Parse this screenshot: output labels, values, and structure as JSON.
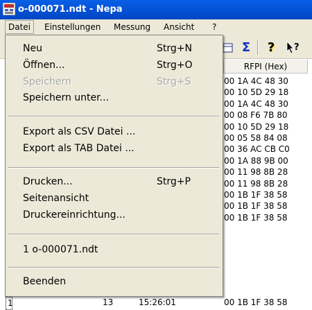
{
  "window": {
    "title": "o-000071.ndt - Nepa"
  },
  "menubar": {
    "items": [
      "Datei",
      "Einstellungen",
      "Messung",
      "Ansicht",
      "?"
    ]
  },
  "toolbar": {
    "sigma_symbol": "Σ",
    "help_symbol": "?"
  },
  "table": {
    "headers": {
      "rfpi": "RFPI (Hex)"
    },
    "rfpi_values": [
      "00 1A 4C 48 30",
      "00 10 5D 29 18",
      "00 1A 4C 48 30",
      "00 08 F6 7B 80",
      "00 10 5D 29 18",
      "00 05 58 84 08",
      "00 36 AC CB C0",
      "00 1A 88 9B 00",
      "00 11 98 8B 28",
      "00 11 98 8B 28",
      "00 1B 1F 38 58",
      "00 1B 1F 38 58",
      "00 1B 1F 38 58"
    ],
    "last_row": {
      "id": "1",
      "count": "13",
      "time": "15:26:01",
      "rfpi": "00 1B 1F 38 58"
    }
  },
  "datei_menu": {
    "new": {
      "label": "Neu",
      "shortcut": "Strg+N"
    },
    "open": {
      "label": "Öffnen...",
      "shortcut": "Strg+O"
    },
    "save": {
      "label": "Speichern",
      "shortcut": "Strg+S",
      "disabled": true
    },
    "save_as": {
      "label": "Speichern unter..."
    },
    "export_csv": {
      "label": "Export als CSV Datei ..."
    },
    "export_tab": {
      "label": "Export als TAB Datei ..."
    },
    "print": {
      "label": "Drucken...",
      "shortcut": "Strg+P"
    },
    "preview": {
      "label": "Seitenansicht"
    },
    "print_setup": {
      "label": "Druckereinrichtung..."
    },
    "recent_1": {
      "label": "1 o-000071.ndt"
    },
    "exit": {
      "label": "Beenden"
    }
  }
}
